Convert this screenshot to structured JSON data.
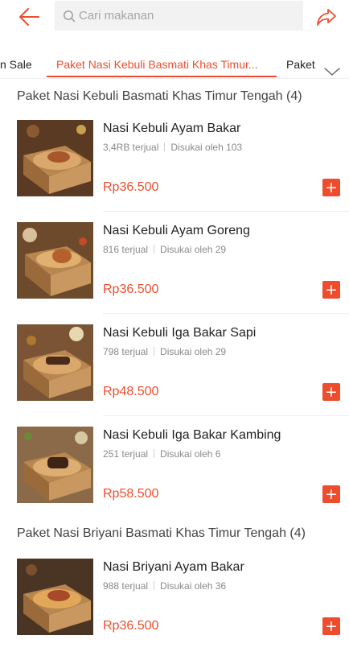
{
  "header": {
    "search_placeholder": "Cari makanan"
  },
  "tabs": {
    "sale_label": "n Sale",
    "active_label": "Paket Nasi Kebuli Basmati Khas Timur...",
    "next_label": "Paket"
  },
  "sections": [
    {
      "title": "Paket Nasi Kebuli Basmati Khas Timur Tengah (4)",
      "items": [
        {
          "name": "Nasi Kebuli Ayam Bakar",
          "sold": "3,4RB terjual",
          "likes": "Disukai oleh 103",
          "price": "Rp36.500"
        },
        {
          "name": "Nasi Kebuli Ayam Goreng",
          "sold": "816 terjual",
          "likes": "Disukai oleh 29",
          "price": "Rp36.500"
        },
        {
          "name": "Nasi Kebuli Iga Bakar Sapi",
          "sold": "798 terjual",
          "likes": "Disukai oleh 29",
          "price": "Rp48.500"
        },
        {
          "name": "Nasi Kebuli Iga Bakar Kambing",
          "sold": "251 terjual",
          "likes": "Disukai oleh 6",
          "price": "Rp58.500"
        }
      ]
    },
    {
      "title": "Paket Nasi Briyani Basmati Khas Timur Tengah (4)",
      "items": [
        {
          "name": "Nasi Briyani Ayam Bakar",
          "sold": "988 terjual",
          "likes": "Disukai oleh 36",
          "price": "Rp36.500"
        }
      ]
    }
  ],
  "add_button_label": "+",
  "colors": {
    "accent": "#ee4d2d",
    "text": "#222222",
    "muted": "#8a8a8a",
    "search_bg": "#f2f2f2"
  }
}
